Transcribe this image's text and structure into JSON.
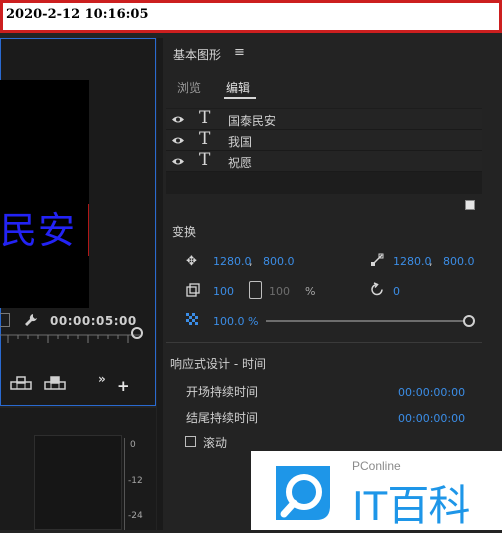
{
  "titlebar": {
    "text": "2020-2-12 10:16:05"
  },
  "program": {
    "video_text": "民安",
    "timecode": "00:00:05:00"
  },
  "audio": {
    "meter_labels": [
      "0",
      "-12",
      "-24"
    ]
  },
  "essential_graphics": {
    "title": "基本图形",
    "menu_glyph": "≡",
    "tabs": [
      {
        "label": "浏览",
        "active": false
      },
      {
        "label": "编辑",
        "active": true
      }
    ],
    "layers": [
      {
        "name": "国泰民安",
        "type_glyph": "T"
      },
      {
        "name": "我国",
        "type_glyph": "T"
      },
      {
        "name": "祝愿",
        "type_glyph": "T"
      }
    ],
    "transform": {
      "label": "变换",
      "position": {
        "x": "1280.0",
        "y": "800.0"
      },
      "anchor": {
        "x": "1280.0",
        "y": "800.0"
      },
      "scale": "100",
      "scale_dim": "100",
      "scale_unit": "%",
      "rotation": "0",
      "opacity": "100.0 %",
      "opacity_fraction": 1.0
    },
    "responsive": {
      "label": "响应式设计 - 时间",
      "open_label": "开场持续时间",
      "open_value": "00:00:00:00",
      "close_label": "结尾持续时间",
      "close_value": "00:00:00:00",
      "roll_label": "滚动",
      "roll_checked": false
    }
  },
  "watermark": {
    "small": "PConline",
    "big": "IT百科"
  },
  "colors": {
    "accent_blue": "#3b8de6",
    "titlebar_border": "#cc1f1f",
    "watermark_blue": "#1e96e8"
  }
}
